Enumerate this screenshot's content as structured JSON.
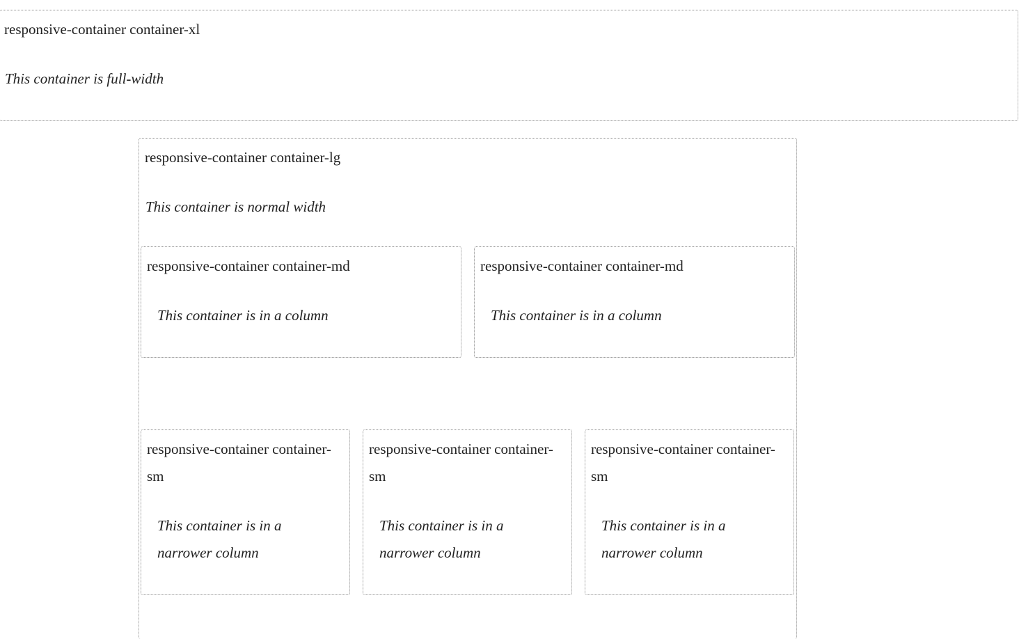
{
  "xl": {
    "label": "responsive-container container-xl",
    "note": "This container is full-width"
  },
  "lg": {
    "label": "responsive-container container-lg",
    "note": "This container is normal width"
  },
  "md_columns": [
    {
      "label": "responsive-container container-md",
      "note": "This container is in a column"
    },
    {
      "label": "responsive-container container-md",
      "note": "This container is in a column"
    }
  ],
  "sm_columns": [
    {
      "label": "responsive-container container-sm",
      "note": "This container is in a narrower column"
    },
    {
      "label": "responsive-container container-sm",
      "note": "This container is in a narrower column"
    },
    {
      "label": "responsive-container container-sm",
      "note": "This container is in a narrower column"
    }
  ]
}
